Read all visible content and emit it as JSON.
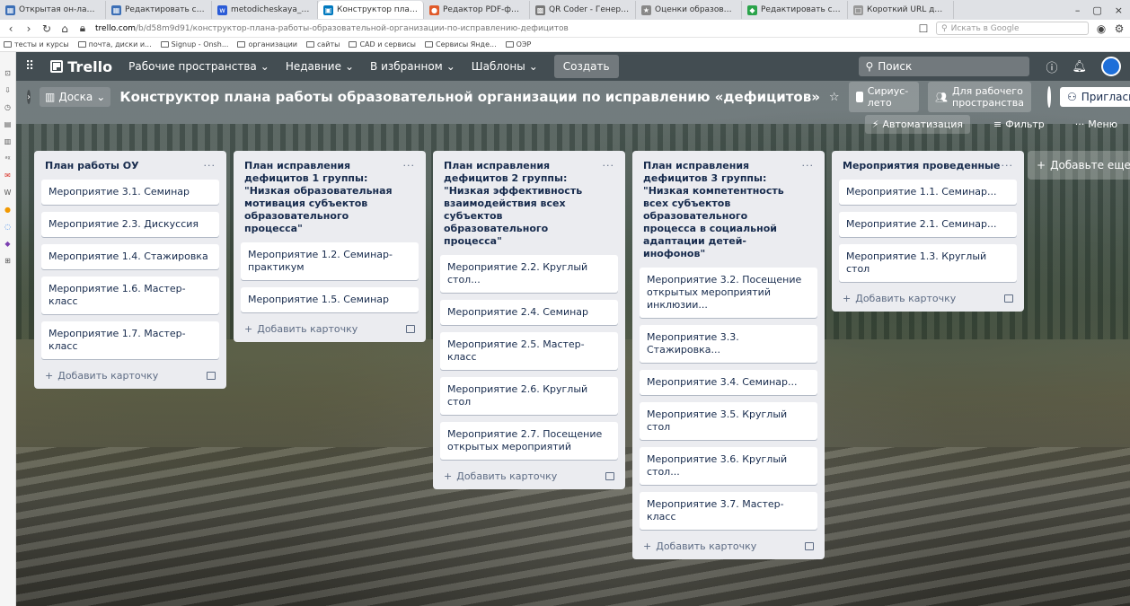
{
  "browser": {
    "tabs": [
      {
        "title": "Открытая он-лайн олимп...",
        "color": "#3c6fb6",
        "glyph": "▦"
      },
      {
        "title": "Редактировать страницу -",
        "color": "#3c6fb6",
        "glyph": "▦"
      },
      {
        "title": "metodicheskaya_razrabotk",
        "color": "#2a5bd7",
        "glyph": "w"
      },
      {
        "title": "Конструктор плана работ",
        "color": "#0079bf",
        "glyph": "▣",
        "active": true
      },
      {
        "title": "Редактор PDF-файлов (pd",
        "color": "#e05a2a",
        "glyph": "●"
      },
      {
        "title": "QR Coder - Генератор QR",
        "color": "#777777",
        "glyph": "▩"
      },
      {
        "title": "Оценки образовательных",
        "color": "#888888",
        "glyph": "★"
      },
      {
        "title": "Редактировать страницу -",
        "color": "#2aa34a",
        "glyph": "◆"
      },
      {
        "title": "Короткий URL для всех!",
        "color": "#999999",
        "glyph": "□"
      }
    ],
    "window_controls": [
      "–",
      "▢",
      "×"
    ],
    "url_host": "trello.com",
    "url_path": "/b/d58m9d91/конструктор-плана-работы-образовательной-организации-по-исправлению-дефицитов",
    "search_placeholder": "Искать в Google",
    "bookmarks": [
      "тесты и курсы",
      "почта, диски и...",
      "Signup - Onsh...",
      "организации",
      "сайты",
      "CAD и сервисы",
      "Сервисы Янде...",
      "ОЭР"
    ]
  },
  "topnav": {
    "logo": "Trello",
    "items": [
      "Рабочие пространства",
      "Недавние",
      "В избранном",
      "Шаблоны"
    ],
    "create": "Создать",
    "search_placeholder": "Поиск"
  },
  "board": {
    "view": "Доска",
    "title": "Конструктор плана работы образовательной организации по исправлению «дефицитов»",
    "workspace": "Сириус-лето",
    "visibility": "Для рабочего пространства",
    "invite": "Пригласить",
    "automation": "Автоматизация",
    "filter": "Фильтр",
    "menu": "Меню",
    "add_list": "Добавьте еще"
  },
  "lists": [
    {
      "title": "План работы ОУ",
      "cards": [
        "Мероприятие 3.1. Семинар",
        "Мероприятие 2.3. Дискуссия",
        "Мероприятие 1.4. Стажировка",
        "Мероприятие 1.6. Мастер-класс",
        "Мероприятие 1.7. Мастер-класс"
      ],
      "add_card": "Добавить карточку"
    },
    {
      "title": "План исправления дефицитов 1 группы: \"Низкая образовательная мотивация субъектов образовательного процесса\"",
      "cards": [
        "Мероприятие 1.2. Семинар-практикум",
        "Мероприятие 1.5. Семинар"
      ],
      "add_card": "Добавить карточку"
    },
    {
      "title": "План исправления дефицитов 2 группы: \"Низкая эффективность взаимодействия всех субъектов образовательного процесса\"",
      "cards": [
        "Мероприятие 2.2. Круглый стол...",
        "Мероприятие 2.4. Семинар",
        "Мероприятие 2.5. Мастер-класс",
        "Мероприятие 2.6. Круглый стол",
        "Мероприятие 2.7. Посещение открытых мероприятий"
      ],
      "add_card": "Добавить карточку"
    },
    {
      "title": "План исправления дефицитов 3 группы: \"Низкая компетентность всех субъектов образовательного процесса в социальной адаптации детей-инофонов\"",
      "cards": [
        "Мероприятие 3.2. Посещение открытых мероприятий инклюзии...",
        "Мероприятие 3.3. Стажировка...",
        "Мероприятие 3.4. Семинар...",
        "Мероприятие 3.5. Круглый стол",
        "Мероприятие 3.6. Круглый стол...",
        "Мероприятие 3.7. Мастер-класс"
      ],
      "add_card": "Добавить карточку"
    },
    {
      "title": "Мероприятия проведенные",
      "cards": [
        "Мероприятие 1.1. Семинар...",
        "Мероприятие 2.1. Семинар...",
        "Мероприятие 1.3. Круглый стол"
      ],
      "add_card": "Добавить карточку"
    }
  ]
}
